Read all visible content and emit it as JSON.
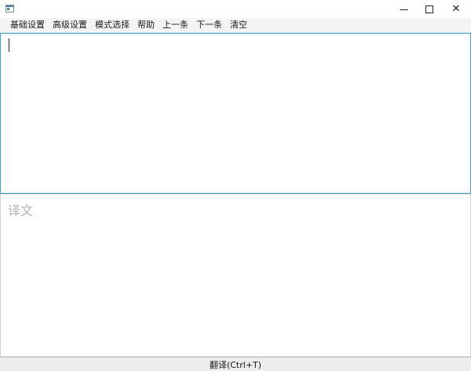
{
  "window": {
    "controls": {
      "minimize_icon": "minimize-icon",
      "maximize_icon": "maximize-icon",
      "close_symbol": "✕"
    }
  },
  "menu": {
    "items": [
      "基础设置",
      "高级设置",
      "模式选择",
      "帮助",
      "上一条",
      "下一条",
      "清空"
    ]
  },
  "source": {
    "value": ""
  },
  "output": {
    "placeholder": "译文"
  },
  "actions": {
    "translate_label": "翻译(Ctrl+T)"
  },
  "colors": {
    "source_border": "#3aa7c4",
    "placeholder_text": "#b3b3b3",
    "menu_background": "#f4f4f4",
    "button_background": "#ececec"
  }
}
